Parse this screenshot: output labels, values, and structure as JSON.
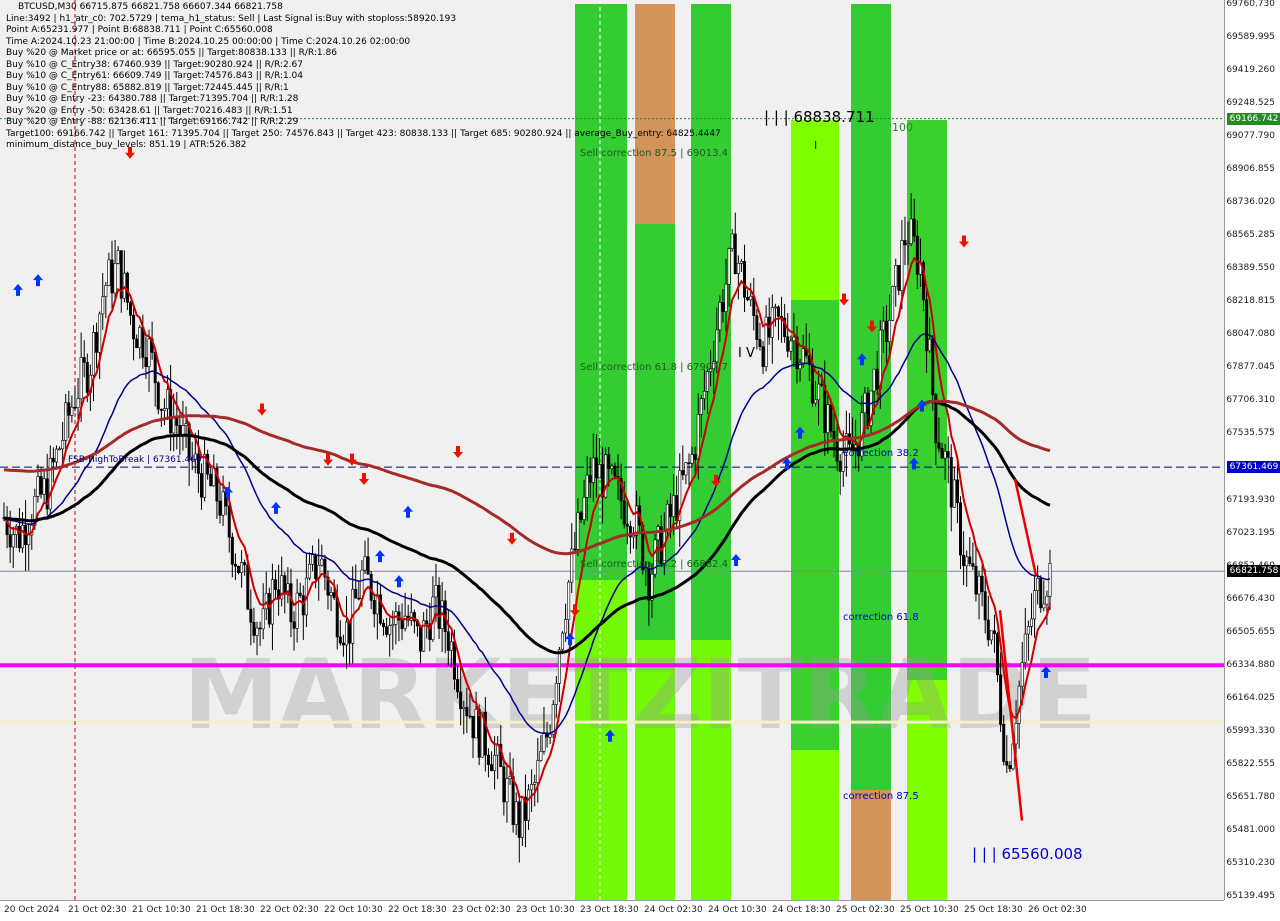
{
  "info": {
    "symbol_line": "BTCUSD,M30  66715.875 66821.758 66607.344 66821.758",
    "lines": [
      "Line:3492 | h1_atr_c0: 702.5729 | tema_h1_status: Sell | Last Signal is:Buy with stoploss:58920.193",
      "Point A:65231.977 | Point B:68838.711 | Point C:65560.008",
      "Time A:2024.10.23 21:00:00 | Time B:2024.10.25 00:00:00 | Time C:2024.10.26 02:00:00",
      "Buy %20 @ Market price or at: 66595.055 || Target:80838.133 || R/R:1.86",
      "Buy %10 @ C_Entry38: 67460.939 || Target:90280.924 || R/R:2.67",
      "Buy %10 @ C_Entry61: 66609.749 || Target:74576.843 || R/R:1.04",
      "Buy %10 @ C_Entry88: 65882.819 || Target:72445.445 || R/R:1",
      "Buy %10 @ Entry -23: 64380.788 || Target:71395.704 || R/R:1.28",
      "Buy %20 @ Entry -50: 63428.61 || Target:70216.483 || R/R:1.51",
      "Buy %20 @ Entry -88: 62136.411 || Target:69166.742 || R/R:2.29",
      "Target100: 69166.742 || Target 161: 71395.704 || Target 250: 74576.843 || Target 423: 80838.133 || Target 685: 90280.924 || average_Buy_entry: 64825.4447",
      "minimum_distance_buy_levels: 851.19 | ATR:526.382"
    ]
  },
  "annotations": {
    "point_b": "| | | 68838.711",
    "point_c": "| | | 65560.008",
    "label_100": "100",
    "sell_corr_875": "Sell correction 87.5 | 69013.4",
    "sell_corr_618": "Sell correction 61.8 | 67902.7",
    "sell_corr_382": "Sell correction 38.2 | 66882.4",
    "corr_382": "correction 38.2",
    "corr_618": "correction 61.8",
    "corr_875": "correction 87.5",
    "fsb": "FSB-HighToBreak | 67361.469",
    "wave_iv": "I V",
    "wave_i": "I",
    "watermark": "MARKETZITRADE"
  },
  "colors": {
    "bg": "#f0f0f0",
    "candle": "#000000",
    "ema_red": "#cc0000",
    "ema_blue": "#00008b",
    "ema_black": "#000000",
    "ema_brown": "#a52a2a",
    "magenta": "#ff00ff",
    "band_green": "#33cc33",
    "band_lime": "#7fff00",
    "band_orange": "#d2945a",
    "target_dotted": "#228b22",
    "fsb_line": "#00008b",
    "current_price_tag": "#000000",
    "fsb_tag": "#0000cc",
    "target_tag": "#228b22"
  },
  "price_axis": {
    "labels": [
      "69760.730",
      "69589.995",
      "69419.260",
      "69248.525",
      "69077.790",
      "68906.855",
      "68736.020",
      "68565.285",
      "68389.550",
      "68218.815",
      "68047.080",
      "67877.045",
      "67706.310",
      "67535.575",
      "67364.840",
      "67193.930",
      "67023.195",
      "66852.460",
      "66676.430",
      "66505.655",
      "66334.880",
      "66164.025",
      "65993.330",
      "65822.555",
      "65651.780",
      "65481.000",
      "65310.230",
      "65139.495"
    ],
    "tag_target": "69166.742",
    "tag_fsb": "67361.469",
    "tag_current": "66821.758"
  },
  "time_axis": {
    "labels": [
      "20 Oct 2024",
      "21 Oct 02:30",
      "21 Oct 10:30",
      "21 Oct 18:30",
      "22 Oct 02:30",
      "22 Oct 10:30",
      "22 Oct 18:30",
      "23 Oct 02:30",
      "23 Oct 10:30",
      "23 Oct 18:30",
      "24 Oct 02:30",
      "24 Oct 10:30",
      "24 Oct 18:30",
      "25 Oct 02:30",
      "25 Oct 10:30",
      "25 Oct 18:30",
      "26 Oct 02:30"
    ]
  },
  "chart_data": {
    "type": "candlestick",
    "symbol": "BTCUSD",
    "timeframe": "M30",
    "ylim": [
      65139.495,
      69760.73
    ],
    "levels": {
      "target_100": 69166.742,
      "fsb_high_to_break": 67361.469,
      "current_price": 66821.758,
      "magenta_level": 66335,
      "pale_yellow_level": 66040,
      "point_b": 68838.711,
      "point_c": 65560.008
    },
    "close_path": [
      67100,
      67000,
      67150,
      67250,
      67500,
      67750,
      67900,
      68300,
      68400,
      68100,
      68000,
      67700,
      67600,
      67400,
      67300,
      67200,
      66950,
      66700,
      66500,
      66800,
      66600,
      66700,
      66900,
      66650,
      66500,
      66800,
      66700,
      66550,
      66600,
      66450,
      66650,
      66500,
      66200,
      66000,
      65900,
      65700,
      65500,
      65700,
      66000,
      66600,
      67000,
      67350,
      67300,
      67200,
      67100,
      66800,
      67000,
      67200,
      67400,
      67800,
      68200,
      68500,
      68200,
      68000,
      68100,
      68050,
      67900,
      67700,
      67500,
      67400,
      67600,
      67900,
      68200,
      68600,
      68400,
      67600,
      67300,
      66900,
      66700,
      66500,
      65800,
      66300,
      66700,
      66820
    ]
  }
}
